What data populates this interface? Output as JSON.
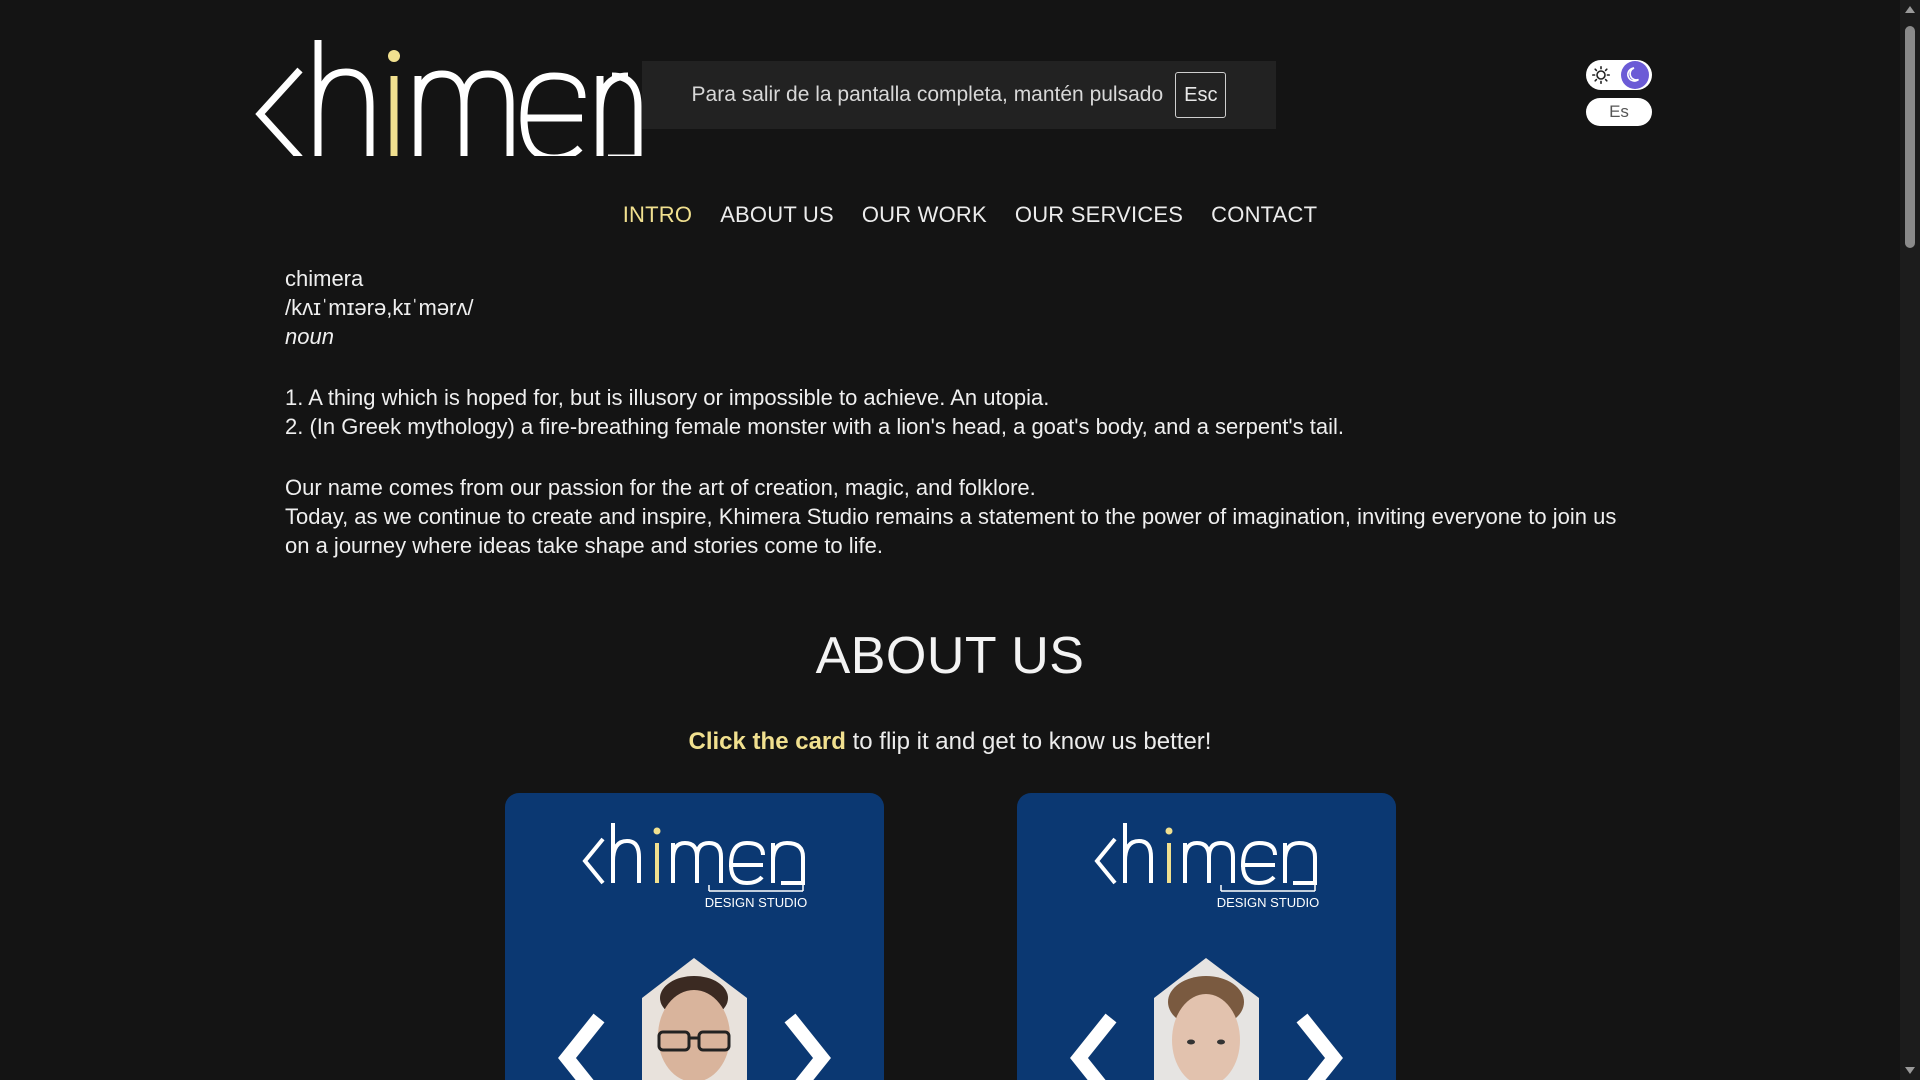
{
  "fullscreen_notice": {
    "text": "Para salir de la pantalla completa, mantén pulsado",
    "key": "Esc"
  },
  "logo": {
    "alt": "khimera",
    "accent_color": "#f1e08f"
  },
  "theme_toggle": {
    "icons": [
      "sun-icon",
      "moon-icon"
    ],
    "active": "dark"
  },
  "language_button": {
    "label": "Es"
  },
  "nav": {
    "items": [
      {
        "label": "INTRO",
        "active": true
      },
      {
        "label": "ABOUT US",
        "active": false
      },
      {
        "label": "OUR WORK",
        "active": false
      },
      {
        "label": "OUR SERVICES",
        "active": false
      },
      {
        "label": "CONTACT",
        "active": false
      }
    ]
  },
  "intro": {
    "word": "chimera",
    "pronunciation": "/kʌɪˈmɪərə,kɪˈmərʌ/",
    "pos": "noun",
    "definitions": [
      "1. A thing which is hoped for, but is illusory or impossible to achieve. An utopia.",
      "2. (In Greek mythology) a fire-breathing female monster with a lion's head, a goat's body, and a serpent's tail."
    ],
    "paragraph_1": "Our name comes from our passion for the art of creation, magic, and folklore.",
    "paragraph_2": "Today, as we continue to create and inspire, Khimera Studio remains a statement to the power of imagination, inviting everyone to join us on a journey where ideas take shape and stories come to life."
  },
  "about": {
    "title": "ABOUT US",
    "subtitle_emphasis": "Click the card",
    "subtitle_rest": " to flip it and get to know us better!",
    "cards": [
      {
        "logo_text": "khimera",
        "tagline": "DESIGN STUDIO"
      },
      {
        "logo_text": "khimera",
        "tagline": "DESIGN STUDIO"
      }
    ]
  },
  "colors": {
    "background": "#141414",
    "accent": "#f1e08f",
    "card": "#0b3872",
    "toggle_active": "#6b5bd6"
  }
}
